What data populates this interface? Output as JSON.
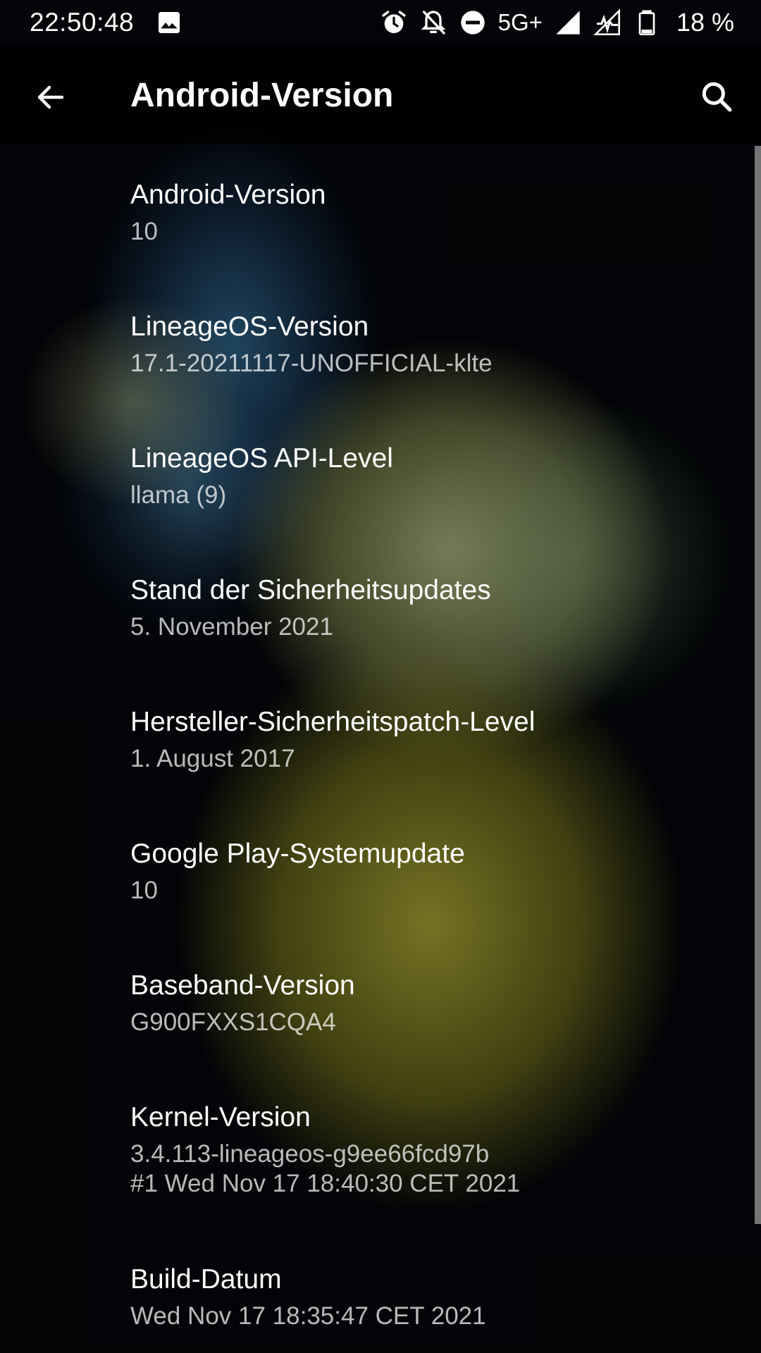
{
  "status_bar": {
    "time": "22:50:48",
    "network_label": "5G+",
    "battery_percent": "18 %",
    "icons": [
      "image-icon",
      "alarm-icon",
      "notifications-off-icon",
      "do-not-disturb-icon",
      "signal-icon",
      "no-sim-signal-icon",
      "battery-icon"
    ]
  },
  "toolbar": {
    "title": "Android-Version",
    "back_icon": "arrow-back-icon",
    "search_icon": "search-icon"
  },
  "items": [
    {
      "title": "Android-Version",
      "summary": "10"
    },
    {
      "title": "LineageOS-Version",
      "summary": "17.1-20211117-UNOFFICIAL-klte"
    },
    {
      "title": "LineageOS API-Level",
      "summary": "llama (9)"
    },
    {
      "title": "Stand der Sicherheitsupdates",
      "summary": "5. November 2021"
    },
    {
      "title": "Hersteller-Sicherheitspatch-Level",
      "summary": "1. August 2017"
    },
    {
      "title": "Google Play-Systemupdate",
      "summary": "10"
    },
    {
      "title": "Baseband-Version",
      "summary": "G900FXXS1CQA4"
    },
    {
      "title": "Kernel-Version",
      "summary": "3.4.113-lineageos-g9ee66fcd97b\n#1 Wed Nov 17 18:40:30 CET 2021"
    },
    {
      "title": "Build-Datum",
      "summary": "Wed Nov 17 18:35:47 CET 2021"
    }
  ],
  "colors": {
    "background": "#05080c",
    "text_primary": "#ffffff",
    "text_secondary": "#c8c8c8",
    "wallpaper_blue": "#2f6f9f",
    "wallpaper_yellow": "#c8c23a"
  }
}
